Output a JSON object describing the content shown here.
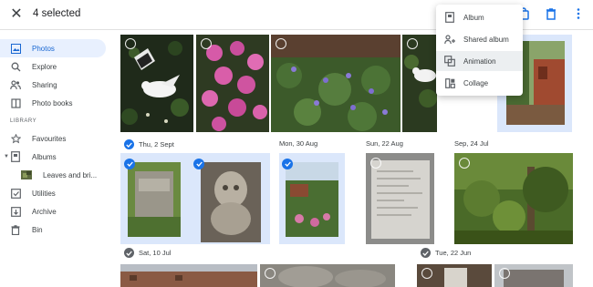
{
  "header": {
    "selected_label": "4 selected"
  },
  "sidebar": {
    "items": [
      {
        "label": "Photos",
        "icon": "photo-icon",
        "active": true
      },
      {
        "label": "Explore",
        "icon": "search-icon"
      },
      {
        "label": "Sharing",
        "icon": "people-icon"
      },
      {
        "label": "Photo books",
        "icon": "book-icon"
      }
    ],
    "library_label": "LIBRARY",
    "library_items": [
      {
        "label": "Favourites",
        "icon": "star-icon"
      },
      {
        "label": "Albums",
        "icon": "album-icon"
      },
      {
        "label": "Leaves and bri...",
        "icon": "album-thumb"
      },
      {
        "label": "Utilities",
        "icon": "utilities-icon"
      },
      {
        "label": "Archive",
        "icon": "archive-icon"
      },
      {
        "label": "Bin",
        "icon": "trash-icon"
      }
    ]
  },
  "menu": {
    "items": [
      {
        "label": "Album",
        "icon": "album-icon"
      },
      {
        "label": "Shared album",
        "icon": "shared-album-icon"
      },
      {
        "label": "Animation",
        "icon": "animation-icon"
      },
      {
        "label": "Collage",
        "icon": "collage-icon"
      }
    ]
  },
  "dates": {
    "thu": "Thu, 2 Sept",
    "mon": "Mon, 30 Aug",
    "sun": "Sun, 22 Aug",
    "sep": "Sep, 24 Jul",
    "sat": "Sat, 10 Jul",
    "tue": "Tue, 22 Jun"
  },
  "colors": {
    "accent": "#1a73e8",
    "selected_bg": "#dbe7fb"
  }
}
